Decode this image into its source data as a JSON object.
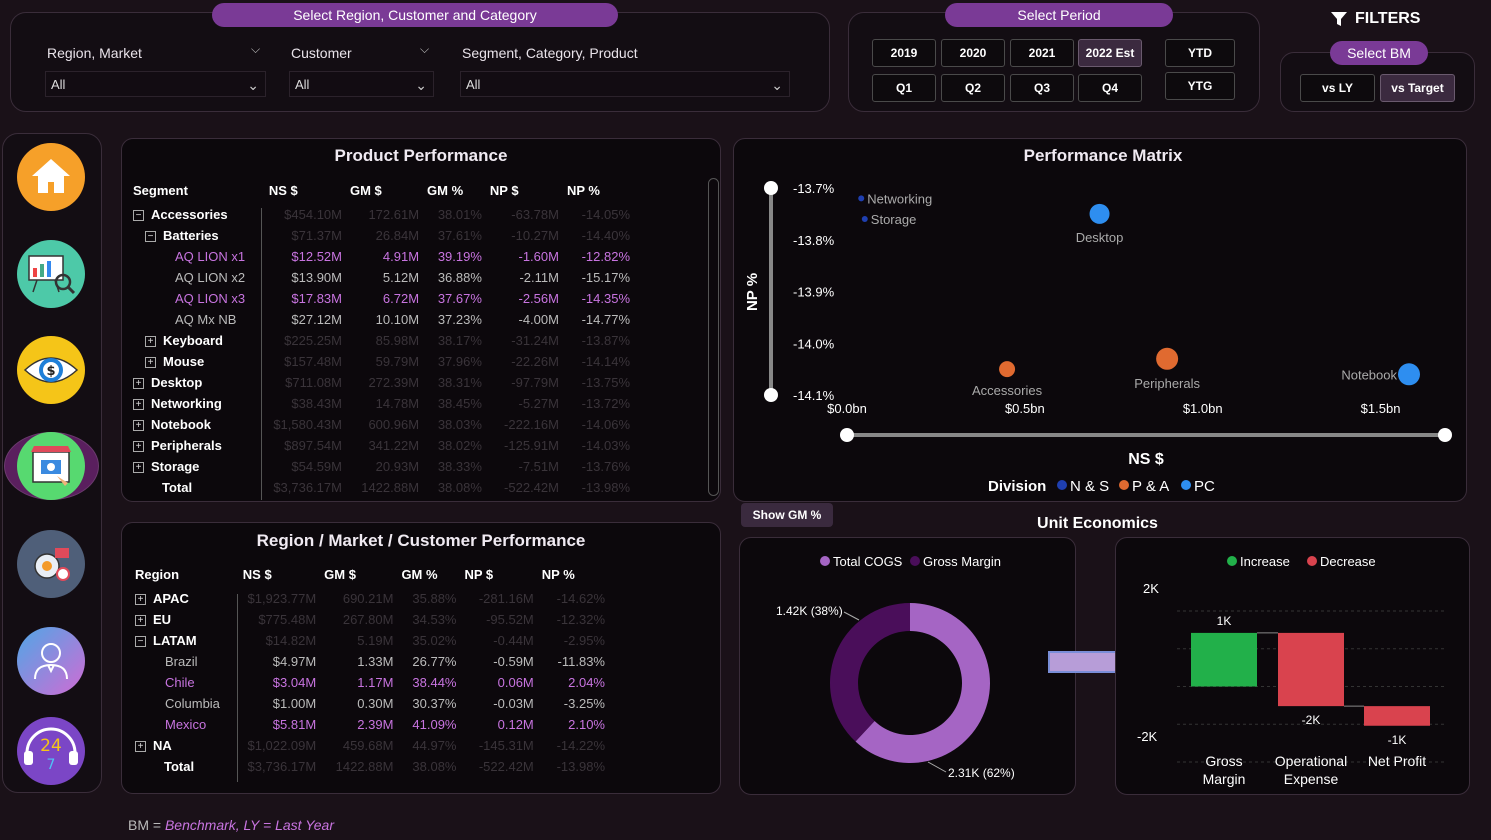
{
  "filters": {
    "pill": "Select Region, Customer and Category",
    "region": {
      "label": "Region, Market",
      "value": "All"
    },
    "customer": {
      "label": "Customer",
      "value": "All"
    },
    "segment": {
      "label": "Segment, Category, Product",
      "value": "All"
    }
  },
  "period": {
    "pill": "Select Period",
    "years": [
      "2019",
      "2020",
      "2021",
      "2022 Est"
    ],
    "quarters": [
      "Q1",
      "Q2",
      "Q3",
      "Q4"
    ],
    "ytd": "YTD",
    "ytg": "YTG",
    "selected_year": "2022 Est"
  },
  "bm": {
    "title": "FILTERS",
    "pill": "Select BM",
    "options": [
      "vs LY",
      "vs Target"
    ],
    "selected": "vs Target"
  },
  "nav": {
    "items": [
      "home",
      "sales-analytics",
      "finance",
      "marketing",
      "supply-chain",
      "executive",
      "support"
    ],
    "selected": "marketing"
  },
  "product_performance": {
    "title": "Product Performance",
    "columns": [
      "Segment",
      "NS $",
      "GM $",
      "GM %",
      "NP $",
      "NP %"
    ],
    "rows": [
      {
        "level": 0,
        "toggle": "minus",
        "name": "Accessories",
        "vals": [
          "$454.10M",
          "172.61M",
          "38.01%",
          "-63.78M",
          "-14.05%"
        ],
        "style": "dim"
      },
      {
        "level": 1,
        "toggle": "minus",
        "name": "Batteries",
        "vals": [
          "$71.37M",
          "26.84M",
          "37.61%",
          "-10.27M",
          "-14.40%"
        ],
        "style": "dim"
      },
      {
        "level": 2,
        "toggle": "",
        "name": "AQ LION x1",
        "vals": [
          "$12.52M",
          "4.91M",
          "39.19%",
          "-1.60M",
          "-12.82%"
        ],
        "style": "leafp"
      },
      {
        "level": 2,
        "toggle": "",
        "name": "AQ LION x2",
        "vals": [
          "$13.90M",
          "5.12M",
          "36.88%",
          "-2.11M",
          "-15.17%"
        ],
        "style": "leaf"
      },
      {
        "level": 2,
        "toggle": "",
        "name": "AQ LION x3",
        "vals": [
          "$17.83M",
          "6.72M",
          "37.67%",
          "-2.56M",
          "-14.35%"
        ],
        "style": "leafp"
      },
      {
        "level": 2,
        "toggle": "",
        "name": "AQ Mx NB",
        "vals": [
          "$27.12M",
          "10.10M",
          "37.23%",
          "-4.00M",
          "-14.77%"
        ],
        "style": "leaf"
      },
      {
        "level": 1,
        "toggle": "plus",
        "name": "Keyboard",
        "vals": [
          "$225.25M",
          "85.98M",
          "38.17%",
          "-31.24M",
          "-13.87%"
        ],
        "style": "dim"
      },
      {
        "level": 1,
        "toggle": "plus",
        "name": "Mouse",
        "vals": [
          "$157.48M",
          "59.79M",
          "37.96%",
          "-22.26M",
          "-14.14%"
        ],
        "style": "dim"
      },
      {
        "level": 0,
        "toggle": "plus",
        "name": "Desktop",
        "vals": [
          "$711.08M",
          "272.39M",
          "38.31%",
          "-97.79M",
          "-13.75%"
        ],
        "style": "dim"
      },
      {
        "level": 0,
        "toggle": "plus",
        "name": "Networking",
        "vals": [
          "$38.43M",
          "14.78M",
          "38.45%",
          "-5.27M",
          "-13.72%"
        ],
        "style": "dim"
      },
      {
        "level": 0,
        "toggle": "plus",
        "name": "Notebook",
        "vals": [
          "$1,580.43M",
          "600.96M",
          "38.03%",
          "-222.16M",
          "-14.06%"
        ],
        "style": "dim"
      },
      {
        "level": 0,
        "toggle": "plus",
        "name": "Peripherals",
        "vals": [
          "$897.54M",
          "341.22M",
          "38.02%",
          "-125.91M",
          "-14.03%"
        ],
        "style": "dim"
      },
      {
        "level": 0,
        "toggle": "plus",
        "name": "Storage",
        "vals": [
          "$54.59M",
          "20.93M",
          "38.33%",
          "-7.51M",
          "-13.76%"
        ],
        "style": "dim"
      },
      {
        "level": 0,
        "toggle": "",
        "name": "Total",
        "vals": [
          "$3,736.17M",
          "1422.88M",
          "38.08%",
          "-522.42M",
          "-13.98%"
        ],
        "style": "dim"
      }
    ]
  },
  "region_performance": {
    "title": "Region / Market / Customer Performance",
    "columns": [
      "Region",
      "NS $",
      "GM $",
      "GM %",
      "NP $",
      "NP %"
    ],
    "rows": [
      {
        "level": 0,
        "toggle": "plus",
        "name": "APAC",
        "vals": [
          "$1,923.77M",
          "690.21M",
          "35.88%",
          "-281.16M",
          "-14.62%"
        ],
        "style": "dim"
      },
      {
        "level": 0,
        "toggle": "plus",
        "name": "EU",
        "vals": [
          "$775.48M",
          "267.80M",
          "34.53%",
          "-95.52M",
          "-12.32%"
        ],
        "style": "dim"
      },
      {
        "level": 0,
        "toggle": "minus",
        "name": "LATAM",
        "vals": [
          "$14.82M",
          "5.19M",
          "35.02%",
          "-0.44M",
          "-2.95%"
        ],
        "style": "dim"
      },
      {
        "level": 1,
        "toggle": "",
        "name": "Brazil",
        "vals": [
          "$4.97M",
          "1.33M",
          "26.77%",
          "-0.59M",
          "-11.83%"
        ],
        "style": "leaf"
      },
      {
        "level": 1,
        "toggle": "",
        "name": "Chile",
        "vals": [
          "$3.04M",
          "1.17M",
          "38.44%",
          "0.06M",
          "2.04%"
        ],
        "style": "leafp"
      },
      {
        "level": 1,
        "toggle": "",
        "name": "Columbia",
        "vals": [
          "$1.00M",
          "0.30M",
          "30.37%",
          "-0.03M",
          "-3.25%"
        ],
        "style": "leaf"
      },
      {
        "level": 1,
        "toggle": "",
        "name": "Mexico",
        "vals": [
          "$5.81M",
          "2.39M",
          "41.09%",
          "0.12M",
          "2.10%"
        ],
        "style": "leafp"
      },
      {
        "level": 0,
        "toggle": "plus",
        "name": "NA",
        "vals": [
          "$1,022.09M",
          "459.68M",
          "44.97%",
          "-145.31M",
          "-14.22%"
        ],
        "style": "dim"
      },
      {
        "level": 0,
        "toggle": "",
        "name": "Total",
        "vals": [
          "$3,736.17M",
          "1422.88M",
          "38.08%",
          "-522.42M",
          "-13.98%"
        ],
        "style": "dim"
      }
    ]
  },
  "performance_matrix": {
    "title": "Performance Matrix",
    "chart_data": {
      "type": "scatter",
      "xlabel": "NS $",
      "ylabel": "NP %",
      "xticks": [
        "$0.0bn",
        "$0.5bn",
        "$1.0bn",
        "$1.5bn"
      ],
      "yticks": [
        "-13.7%",
        "-13.8%",
        "-13.9%",
        "-14.0%",
        "-14.1%"
      ],
      "xlim": [
        0,
        1.58
      ],
      "ylim": [
        -14.1,
        -13.7
      ],
      "legend_title": "Division",
      "legend": [
        {
          "name": "N & S",
          "color": "#1f3fb0"
        },
        {
          "name": "P & A",
          "color": "#e06a30"
        },
        {
          "name": "PC",
          "color": "#2e8ef0"
        }
      ],
      "points": [
        {
          "label": "Networking",
          "x": 0.04,
          "y": -13.72,
          "division": "N & S"
        },
        {
          "label": "Storage",
          "x": 0.05,
          "y": -13.76,
          "division": "N & S"
        },
        {
          "label": "Desktop",
          "x": 0.71,
          "y": -13.75,
          "division": "PC"
        },
        {
          "label": "Accessories",
          "x": 0.45,
          "y": -14.05,
          "division": "P & A"
        },
        {
          "label": "Peripherals",
          "x": 0.9,
          "y": -14.03,
          "division": "P & A"
        },
        {
          "label": "Notebook",
          "x": 1.58,
          "y": -14.06,
          "division": "PC"
        }
      ]
    }
  },
  "unit_economics": {
    "title": "Unit Economics",
    "show_btn": "Show GM %",
    "donut": {
      "chart_data": {
        "type": "pie",
        "series": [
          {
            "name": "Total COGS",
            "value": 2.31,
            "label": "2.31K (62%)",
            "color": "#a565c4"
          },
          {
            "name": "Gross Margin",
            "value": 1.42,
            "label": "1.42K (38%)",
            "color": "#4a0e5a"
          }
        ]
      }
    },
    "waterfall": {
      "chart_data": {
        "type": "bar",
        "categories": [
          "Gross Margin",
          "Operational Expense",
          "Net Profit"
        ],
        "category_lines": [
          [
            "Gross",
            "Margin"
          ],
          [
            "Operational",
            "Expense"
          ],
          [
            "Net Profit"
          ]
        ],
        "values": [
          1.42,
          -1.94,
          -0.52
        ],
        "data_labels": [
          "1K",
          "-2K",
          "-1K"
        ],
        "legend": [
          {
            "name": "Increase",
            "color": "#22b04a"
          },
          {
            "name": "Decrease",
            "color": "#d9434e"
          }
        ],
        "yticks": [
          "2K",
          "-2K"
        ],
        "ylim": [
          -2,
          2
        ]
      }
    }
  },
  "footer": {
    "prefix": "BM = ",
    "text": "Benchmark, LY = Last Year"
  }
}
